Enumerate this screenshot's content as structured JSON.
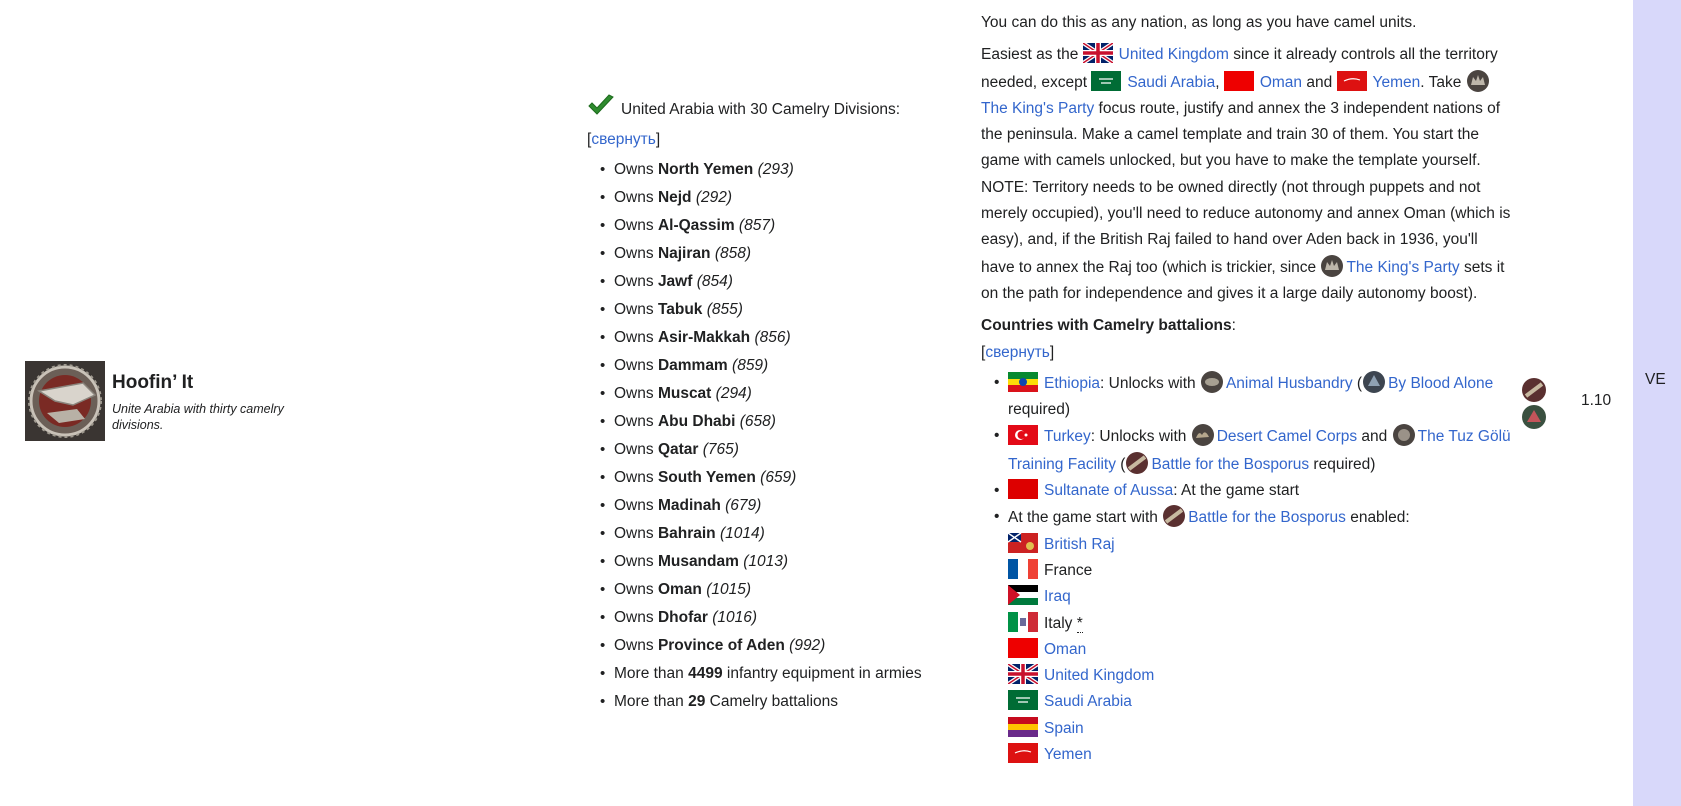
{
  "achievement": {
    "title": "Hoofin’ It",
    "description": "Unite Arabia with thirty camelry divisions."
  },
  "requirements": {
    "header": "United Arabia with 30 Camelry Divisions:",
    "collapse": "свернуть",
    "items": [
      {
        "pre": "Owns ",
        "bold": "North Yemen",
        "id": "(293)"
      },
      {
        "pre": "Owns ",
        "bold": "Nejd",
        "id": "(292)"
      },
      {
        "pre": "Owns ",
        "bold": "Al-Qassim",
        "id": "(857)"
      },
      {
        "pre": "Owns ",
        "bold": "Najiran",
        "id": "(858)"
      },
      {
        "pre": "Owns ",
        "bold": "Jawf",
        "id": "(854)"
      },
      {
        "pre": "Owns ",
        "bold": "Tabuk",
        "id": "(855)"
      },
      {
        "pre": "Owns ",
        "bold": "Asir-Makkah",
        "id": "(856)"
      },
      {
        "pre": "Owns ",
        "bold": "Dammam",
        "id": "(859)"
      },
      {
        "pre": "Owns ",
        "bold": "Muscat",
        "id": "(294)"
      },
      {
        "pre": "Owns ",
        "bold": "Abu Dhabi",
        "id": "(658)"
      },
      {
        "pre": "Owns ",
        "bold": "Qatar",
        "id": "(765)"
      },
      {
        "pre": "Owns ",
        "bold": "South Yemen",
        "id": "(659)"
      },
      {
        "pre": "Owns ",
        "bold": "Madinah",
        "id": "(679)"
      },
      {
        "pre": "Owns ",
        "bold": "Bahrain",
        "id": "(1014)"
      },
      {
        "pre": "Owns ",
        "bold": "Musandam",
        "id": "(1013)"
      },
      {
        "pre": "Owns ",
        "bold": "Oman",
        "id": "(1015)"
      },
      {
        "pre": "Owns ",
        "bold": "Dhofar",
        "id": "(1016)"
      },
      {
        "pre": "Owns ",
        "bold": "Province of Aden",
        "id": "(992)"
      }
    ],
    "equipment": {
      "pre": "More than ",
      "bold": "4499",
      "post": " infantry equipment in armies"
    },
    "battalions": {
      "pre": "More than ",
      "bold": "29",
      "post": " Camelry battalions"
    }
  },
  "notes": {
    "line1": "You can do this as any nation, as long as you have camel units.",
    "p2": {
      "t1": "Easiest as the ",
      "uk": "United Kingdom",
      "t2": " since it already controls all the territory needed, except ",
      "saudi": "Saudi Arabia",
      "comma": ", ",
      "oman": "Oman",
      "and": " and ",
      "yemen": "Yemen",
      "t3": ". Take ",
      "kings_party": "The King's Party",
      "t4": " focus route, justify and annex the 3 independent nations of the peninsula. Make a camel template and train 30 of them. You start the game with camels unlocked, but you have to make the template yourself. NOTE: Territory needs to be owned directly (not through puppets and not merely occupied), you'll need to reduce autonomy and annex Oman (which is easy), and, if the British Raj failed to hand over Aden back in 1936, you'll have to annex the Raj too (which is trickier, since ",
      "kings_party2": "The King's Party",
      "t5": " sets it on the path for independence and gives it a large daily autonomy boost)."
    },
    "countries_heading": "Countries with Camelry battalions",
    "colon": ":",
    "collapse": "свернуть",
    "ethiopia": {
      "name": "Ethiopia",
      "t1": ": Unlocks with ",
      "focus": "Animal Husbandry",
      "paren": " (",
      "focus2": "By Blood Alone",
      "t2": " required)"
    },
    "turkey": {
      "name": "Turkey",
      "t1": ": Unlocks with ",
      "focus": "Desert Camel Corps",
      "and": " and ",
      "focus2": "The Tuz Gölü Training Facility",
      "paren": " (",
      "dlc": "Battle for the Bosporus",
      "t2": " required)"
    },
    "aussa": {
      "name": "Sultanate of Aussa",
      "t1": ": At the game start"
    },
    "start": {
      "t1": "At the game start with ",
      "dlc": "Battle for the Bosporus",
      "t2": " enabled:"
    },
    "start_countries": [
      "British Raj",
      "France",
      "Iraq",
      "Italy",
      "Oman",
      "United Kingdom",
      "Saudi Arabia",
      "Spain",
      "Yemen"
    ],
    "italy_star": "*"
  },
  "version": "1.10",
  "ve": "VE",
  "colors": {
    "link": "#3366cc",
    "ve_bg": "#d8d8fa",
    "check": "#2e8b2e"
  }
}
